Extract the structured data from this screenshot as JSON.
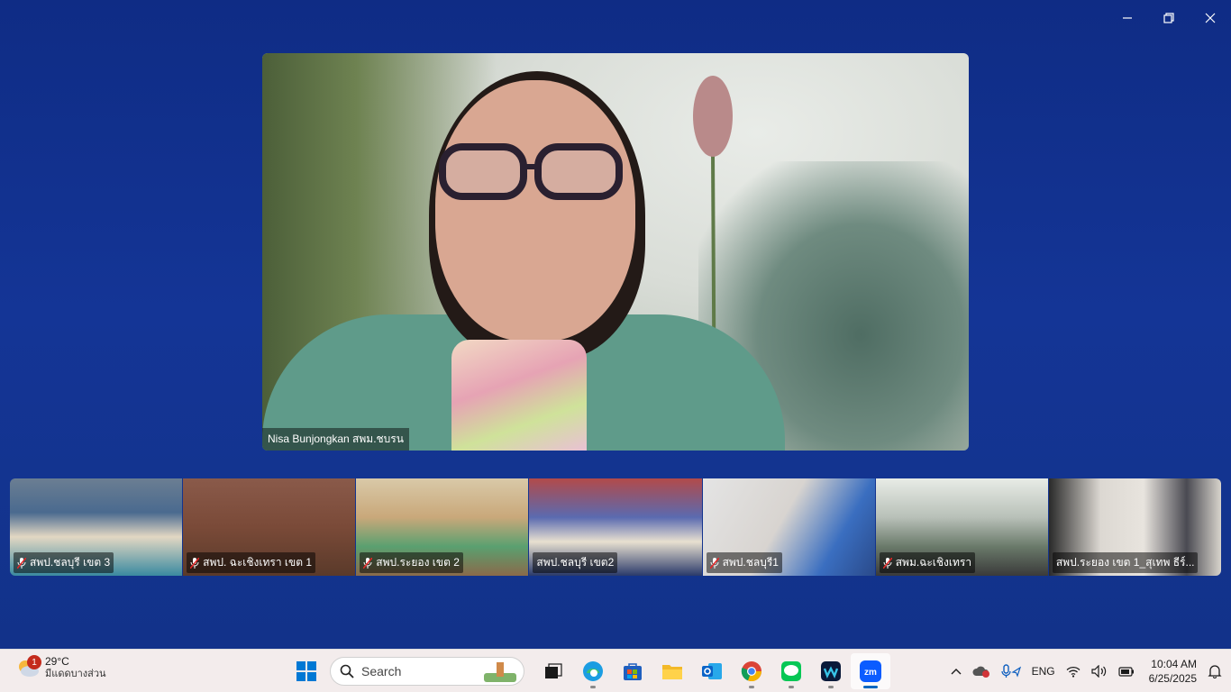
{
  "main_video": {
    "name": "Nisa Bunjongkan สพม.ชบรน"
  },
  "participants": [
    {
      "name": "สพป.ชลบุรี เขต 3"
    },
    {
      "name": "สพป. ฉะเชิงเทรา เขต 1"
    },
    {
      "name": "สพป.ระยอง เขต 2"
    },
    {
      "name": "สพป.ชลบุรี เขต2"
    },
    {
      "name": "สพป.ชลบุรี1"
    },
    {
      "name": "สพม.ฉะเชิงเทรา"
    },
    {
      "name": "สพป.ระยอง เขต 1_สุเทพ ธีร์..."
    }
  ],
  "taskbar": {
    "weather": {
      "temp": "29°C",
      "condition": "มีแดดบางส่วน",
      "badge": "1"
    },
    "search_placeholder": "Search",
    "apps": [
      "start-icon",
      "task-view-icon",
      "edge-icon",
      "store-icon",
      "file-explorer-icon",
      "outlook-icon",
      "chrome-icon",
      "line-icon",
      "webex-icon",
      "zoom-icon"
    ],
    "tray": {
      "lang": "ENG"
    },
    "clock": {
      "time": "10:04 AM",
      "date": "6/25/2025"
    }
  },
  "colors": {
    "background": "#143596",
    "taskbar": "#f3ecec",
    "accent": "#0067c0"
  }
}
